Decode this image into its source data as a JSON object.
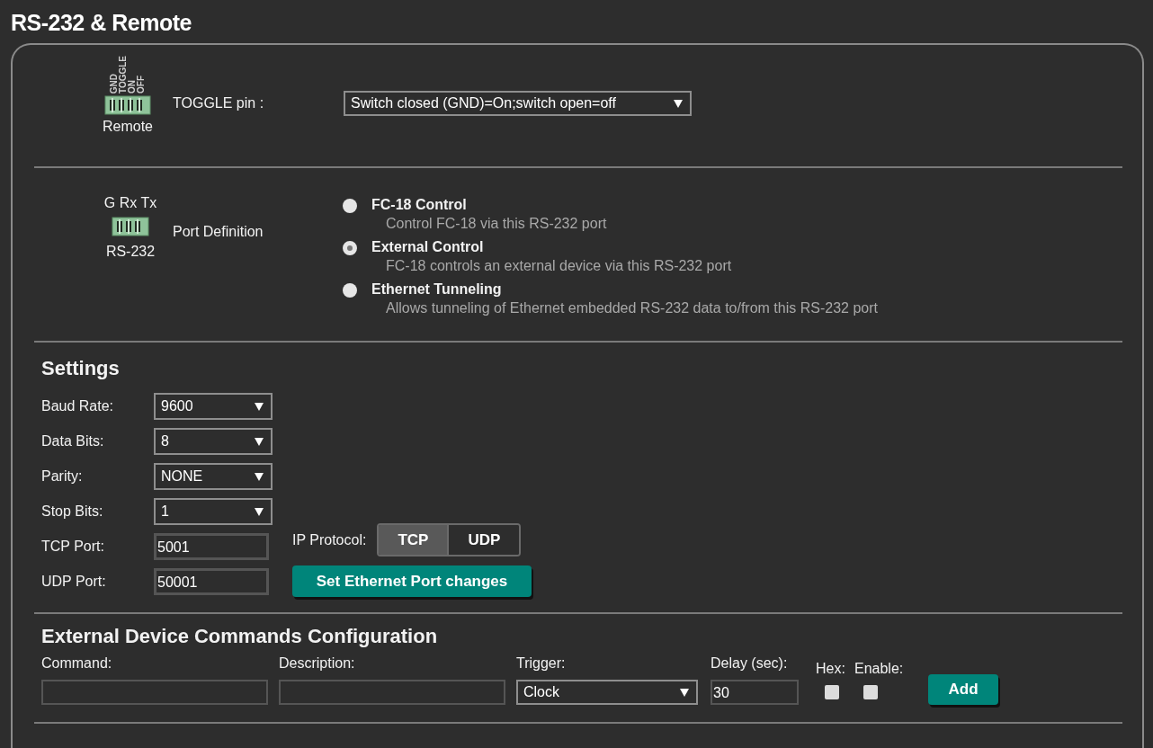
{
  "title": "RS-232 & Remote",
  "remote": {
    "pins": [
      "GND",
      "TOGGLE",
      "ON",
      "OFF"
    ],
    "label": "Remote",
    "field_label": "TOGGLE pin :",
    "select_value": "Switch closed (GND)=On;switch open=off"
  },
  "rs232": {
    "pins": "G Rx Tx",
    "label": "RS-232",
    "field_label": "Port Definition",
    "options": [
      {
        "title": "FC-18 Control",
        "description": "Control FC-18 via this RS-232 port",
        "selected": false
      },
      {
        "title": "External Control",
        "description": "FC-18 controls an external device via this RS-232 port",
        "selected": true
      },
      {
        "title": "Ethernet Tunneling",
        "description": "Allows tunneling of Ethernet embedded RS-232 data to/from this RS-232 port",
        "selected": false
      }
    ]
  },
  "settings": {
    "heading": "Settings",
    "selects": [
      {
        "label": "Baud Rate:",
        "value": "9600"
      },
      {
        "label": "Data Bits:",
        "value": "8"
      },
      {
        "label": "Parity:",
        "value": "NONE"
      },
      {
        "label": "Stop Bits:",
        "value": "1"
      }
    ],
    "ports": [
      {
        "label": "TCP Port:",
        "value": "5001"
      },
      {
        "label": "UDP Port:",
        "value": "50001"
      }
    ],
    "ip_protocol": {
      "label": "IP Protocol:",
      "options": [
        {
          "label": "TCP",
          "selected": true
        },
        {
          "label": "UDP",
          "selected": false
        }
      ]
    },
    "apply_button": "Set Ethernet Port changes"
  },
  "commands": {
    "heading": "External Device Commands Configuration",
    "fields": [
      {
        "label": "Command:",
        "kind": "text"
      },
      {
        "label": "Description:",
        "kind": "text"
      },
      {
        "label": "Trigger:",
        "kind": "select",
        "value": "Clock"
      },
      {
        "label": "Delay (sec):",
        "kind": "text",
        "value": "30"
      },
      {
        "label": "Hex:",
        "kind": "checkbox",
        "checked": false
      },
      {
        "label": "Enable:",
        "kind": "checkbox",
        "checked": false
      }
    ],
    "add_button": "Add"
  }
}
